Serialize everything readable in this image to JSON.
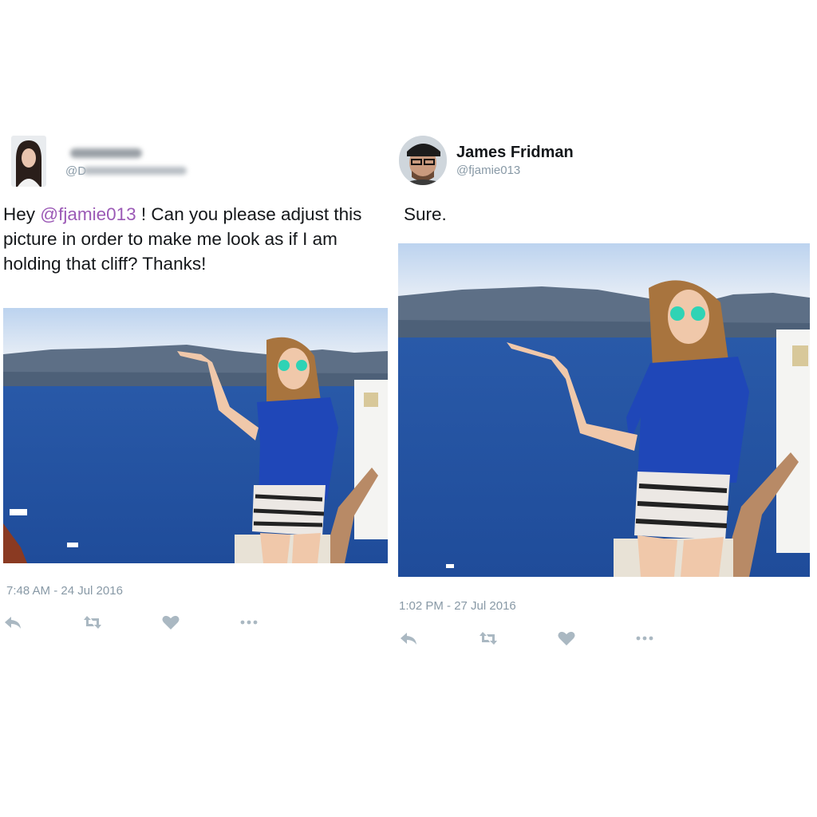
{
  "left_tweet": {
    "text_prefix": "Hey ",
    "mention": "@fjamie013",
    "text_suffix": " ! Can you please adjust this picture in order to make me look as if I am holding that cliff? Thanks!",
    "handle_partial": "@D",
    "timestamp": "7:48 AM - 24 Jul 2016"
  },
  "right_tweet": {
    "name": "James Fridman",
    "handle": "@fjamie013",
    "text": "Sure.",
    "timestamp": "1:02 PM - 27 Jul 2016"
  },
  "colors": {
    "mention": "#9b59b6",
    "meta": "#8899a6",
    "icon": "#aab8c2",
    "sea": "#2f64b4",
    "sky": "#dbe6f4"
  },
  "icons": [
    "reply-icon",
    "retweet-icon",
    "like-icon",
    "more-icon"
  ]
}
